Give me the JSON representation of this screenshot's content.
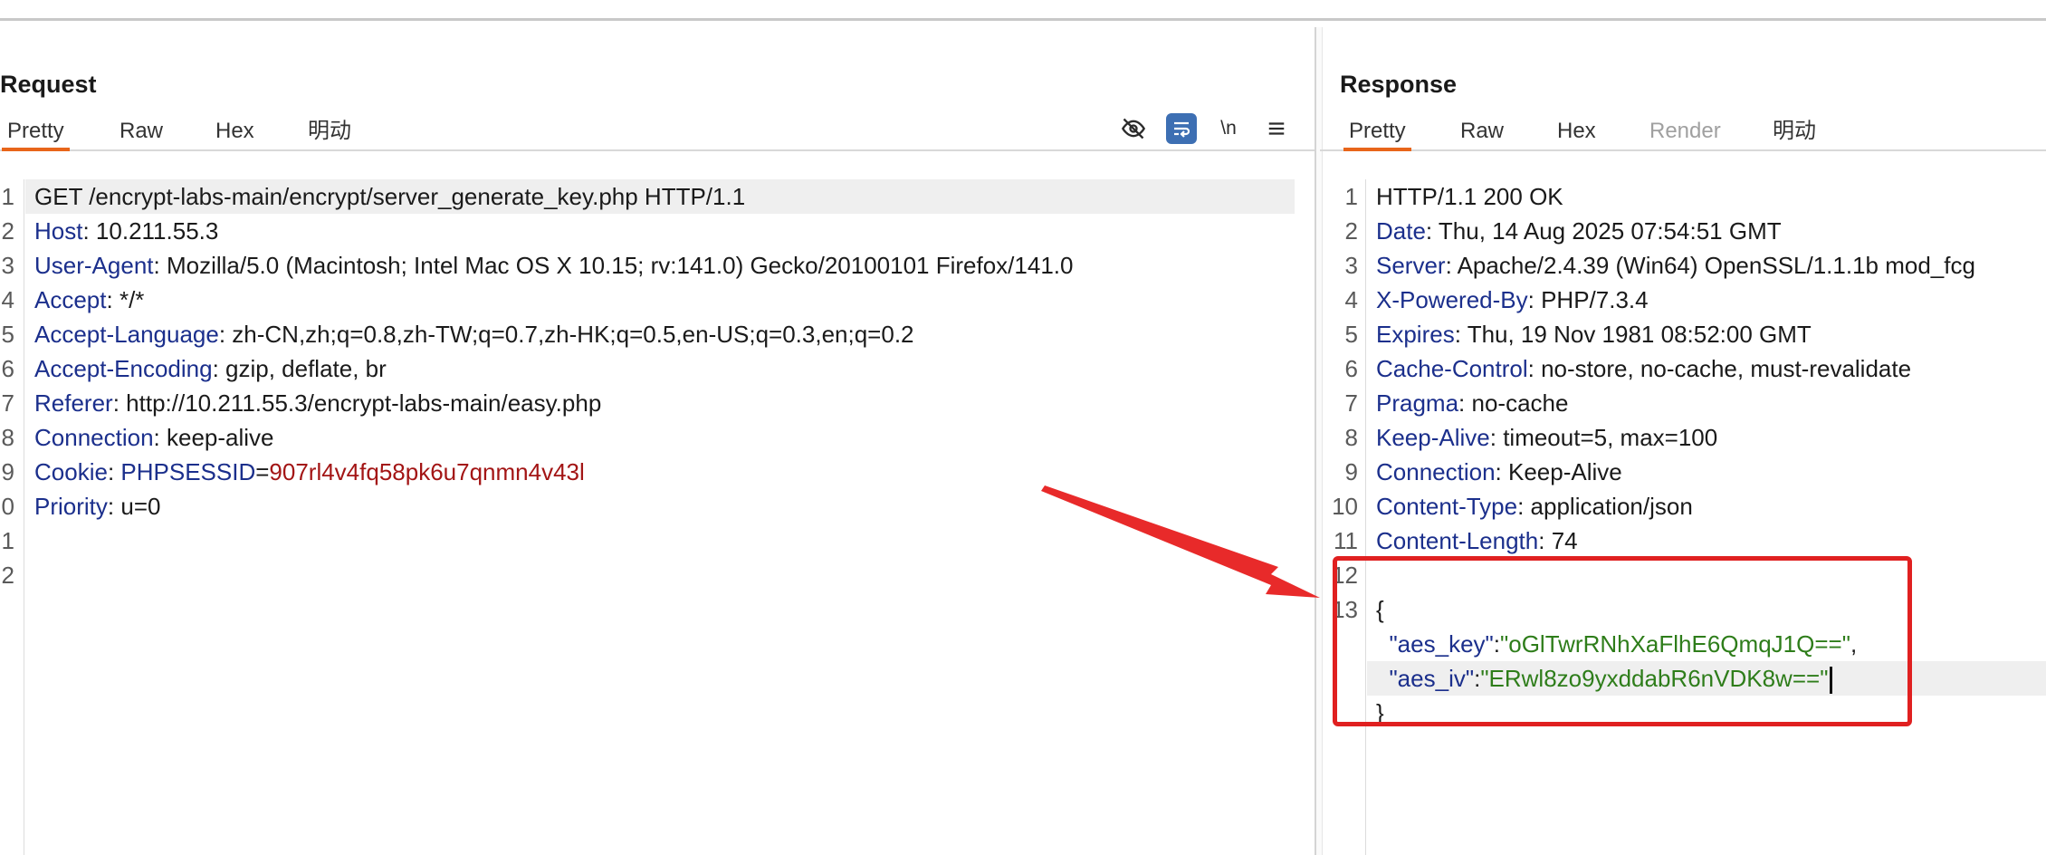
{
  "request": {
    "title": "Request",
    "tabs": [
      {
        "label": "Pretty",
        "active": true
      },
      {
        "label": "Raw",
        "active": false
      },
      {
        "label": "Hex",
        "active": false
      },
      {
        "label": "明动",
        "active": false
      }
    ],
    "toolbar": {
      "hide_icon": "eye-off-icon",
      "wrap_icon": "word-wrap-icon",
      "newline_label": "\\n",
      "menu_icon": "hamburger-menu-icon"
    },
    "lines": [
      {
        "num": "1",
        "text": "GET /encrypt-labs-main/encrypt/server_generate_key.php HTTP/1.1"
      },
      {
        "num": "2",
        "name": "Host",
        "sep": ": ",
        "value": "10.211.55.3"
      },
      {
        "num": "3",
        "name": "User-Agent",
        "sep": ": ",
        "value": "Mozilla/5.0 (Macintosh; Intel Mac OS X 10.15; rv:141.0) Gecko/20100101 Firefox/141.0"
      },
      {
        "num": "4",
        "name": "Accept",
        "sep": ": ",
        "value": "*/*"
      },
      {
        "num": "5",
        "name": "Accept-Language",
        "sep": ": ",
        "value": "zh-CN,zh;q=0.8,zh-TW;q=0.7,zh-HK;q=0.5,en-US;q=0.3,en;q=0.2"
      },
      {
        "num": "6",
        "name": "Accept-Encoding",
        "sep": ": ",
        "value": "gzip, deflate, br"
      },
      {
        "num": "7",
        "name": "Referer",
        "sep": ": ",
        "value": "http://10.211.55.3/encrypt-labs-main/easy.php"
      },
      {
        "num": "8",
        "name": "Connection",
        "sep": ": ",
        "value": "keep-alive"
      },
      {
        "num": "9",
        "name": "Cookie",
        "sep": ": ",
        "cookie_name": "PHPSESSID",
        "cookie_eq": "=",
        "cookie_value": "907rl4v4fq58pk6u7qnmn4v43l"
      },
      {
        "num": "0",
        "name": "Priority",
        "sep": ": ",
        "value": "u=0"
      },
      {
        "num": "1"
      },
      {
        "num": "2"
      }
    ]
  },
  "response": {
    "title": "Response",
    "tabs": [
      {
        "label": "Pretty",
        "active": true
      },
      {
        "label": "Raw",
        "active": false
      },
      {
        "label": "Hex",
        "active": false
      },
      {
        "label": "Render",
        "active": false,
        "disabled": true
      },
      {
        "label": "明动",
        "active": false
      }
    ],
    "lines": [
      {
        "num": "1",
        "text": "HTTP/1.1 200 OK"
      },
      {
        "num": "2",
        "name": "Date",
        "sep": ": ",
        "value": "Thu, 14 Aug 2025 07:54:51 GMT"
      },
      {
        "num": "3",
        "name": "Server",
        "sep": ": ",
        "value": "Apache/2.4.39 (Win64) OpenSSL/1.1.1b mod_fcg"
      },
      {
        "num": "4",
        "name": "X-Powered-By",
        "sep": ": ",
        "value": "PHP/7.3.4"
      },
      {
        "num": "5",
        "name": "Expires",
        "sep": ": ",
        "value": "Thu, 19 Nov 1981 08:52:00 GMT"
      },
      {
        "num": "6",
        "name": "Cache-Control",
        "sep": ": ",
        "value": "no-store, no-cache, must-revalidate"
      },
      {
        "num": "7",
        "name": "Pragma",
        "sep": ": ",
        "value": "no-cache"
      },
      {
        "num": "8",
        "name": "Keep-Alive",
        "sep": ": ",
        "value": "timeout=5, max=100"
      },
      {
        "num": "9",
        "name": "Connection",
        "sep": ": ",
        "value": "Keep-Alive"
      },
      {
        "num": "10",
        "name": "Content-Type",
        "sep": ": ",
        "value": "application/json"
      },
      {
        "num": "11",
        "name": "Content-Length",
        "sep": ": ",
        "value": "74"
      },
      {
        "num": "12"
      },
      {
        "num": "13",
        "text": "{"
      },
      {
        "num": "",
        "indent": "  ",
        "json_key": "\"aes_key\"",
        "colon": ":",
        "json_value": "\"oGlTwrRNhXaFlhE6QmqJ1Q==\"",
        "comma": ","
      },
      {
        "num": "",
        "indent": "  ",
        "json_key": "\"aes_iv\"",
        "colon": ":",
        "json_value": "\"ERwl8zo9yxddabR6nVDK8w==\""
      },
      {
        "num": "",
        "text": "}"
      }
    ]
  },
  "colors": {
    "accent_tab_underline": "#e8651a",
    "annotation_red": "#e02020",
    "header_name": "#1b2f8c",
    "json_string": "#2e7d1a",
    "cookie_value": "#a31515",
    "toolbar_selected": "#3d6fb3"
  }
}
